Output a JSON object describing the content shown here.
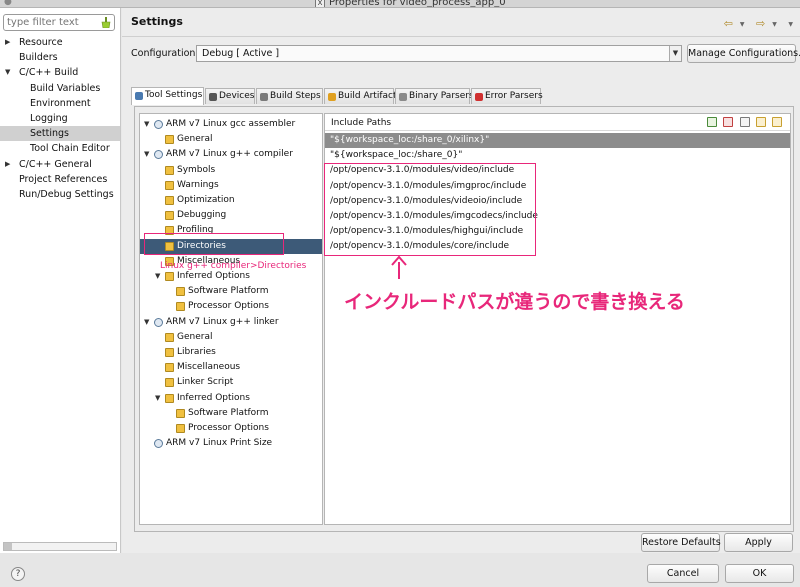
{
  "window": {
    "title": "Properties for video_process_app_0"
  },
  "sidebar": {
    "filter_placeholder": "type filter text",
    "items": [
      {
        "label": "Resource",
        "level": 0,
        "expandable": true,
        "expanded": false
      },
      {
        "label": "Builders",
        "level": 0,
        "expandable": false
      },
      {
        "label": "C/C++ Build",
        "level": 0,
        "expandable": true,
        "expanded": true
      },
      {
        "label": "Build Variables",
        "level": 1
      },
      {
        "label": "Environment",
        "level": 1
      },
      {
        "label": "Logging",
        "level": 1
      },
      {
        "label": "Settings",
        "level": 1,
        "selected": true
      },
      {
        "label": "Tool Chain Editor",
        "level": 1
      },
      {
        "label": "C/C++ General",
        "level": 0,
        "expandable": true,
        "expanded": false
      },
      {
        "label": "Project References",
        "level": 0
      },
      {
        "label": "Run/Debug Settings",
        "level": 0
      }
    ]
  },
  "page": {
    "title": "Settings",
    "configuration_label": "Configuration:",
    "configuration_value": "Debug  [ Active ]",
    "manage_button": "Manage Configurations..."
  },
  "tabs": [
    {
      "label": "Tool Settings",
      "active": true,
      "icon_color": "#4a7ab0"
    },
    {
      "label": "Devices",
      "icon_color": "#555555"
    },
    {
      "label": "Build Steps",
      "icon_color": "#7a7a7a"
    },
    {
      "label": "Build Artifact",
      "icon_color": "#e0a020"
    },
    {
      "label": "Binary Parsers",
      "icon_color": "#8a8a8a"
    },
    {
      "label": "Error Parsers",
      "icon_color": "#d03030"
    }
  ],
  "tree": [
    {
      "label": "ARM v7 Linux gcc assembler",
      "level": 0,
      "type": "tool"
    },
    {
      "label": "General",
      "level": 1,
      "type": "option"
    },
    {
      "label": "ARM v7 Linux g++ compiler",
      "level": 0,
      "type": "tool"
    },
    {
      "label": "Symbols",
      "level": 1,
      "type": "option"
    },
    {
      "label": "Warnings",
      "level": 1,
      "type": "option"
    },
    {
      "label": "Optimization",
      "level": 1,
      "type": "option"
    },
    {
      "label": "Debugging",
      "level": 1,
      "type": "option"
    },
    {
      "label": "Profiling",
      "level": 1,
      "type": "option"
    },
    {
      "label": "Directories",
      "level": 1,
      "type": "option",
      "selected": true
    },
    {
      "label": "Miscellaneous",
      "level": 1,
      "type": "option"
    },
    {
      "label": "Inferred Options",
      "level": 1,
      "type": "group"
    },
    {
      "label": "Software Platform",
      "level": 2,
      "type": "option"
    },
    {
      "label": "Processor Options",
      "level": 2,
      "type": "option"
    },
    {
      "label": "ARM v7 Linux g++ linker",
      "level": 0,
      "type": "tool"
    },
    {
      "label": "General",
      "level": 1,
      "type": "option"
    },
    {
      "label": "Libraries",
      "level": 1,
      "type": "option"
    },
    {
      "label": "Miscellaneous",
      "level": 1,
      "type": "option"
    },
    {
      "label": "Linker Script",
      "level": 1,
      "type": "option"
    },
    {
      "label": "Inferred Options",
      "level": 1,
      "type": "group"
    },
    {
      "label": "Software Platform",
      "level": 2,
      "type": "option"
    },
    {
      "label": "Processor Options",
      "level": 2,
      "type": "option"
    },
    {
      "label": "ARM v7 Linux Print Size",
      "level": 0,
      "type": "tool-leaf"
    }
  ],
  "include_paths": {
    "title": "Include Paths",
    "items": [
      {
        "value": "\"${workspace_loc:/share_0/xilinx}\"",
        "selected": true
      },
      {
        "value": "\"${workspace_loc:/share_0}\""
      },
      {
        "value": "/opt/opencv-3.1.0/modules/video/include"
      },
      {
        "value": "/opt/opencv-3.1.0/modules/imgproc/include"
      },
      {
        "value": "/opt/opencv-3.1.0/modules/videoio/include"
      },
      {
        "value": "/opt/opencv-3.1.0/modules/imgcodecs/include"
      },
      {
        "value": "/opt/opencv-3.1.0/modules/highgui/include"
      },
      {
        "value": "/opt/opencv-3.1.0/modules/core/include"
      }
    ]
  },
  "annotations": {
    "directories_label": "Linux g++ compiler>Directories",
    "callout_text": "インクルードパスが違うので書き換える",
    "color": "#e8277a"
  },
  "buttons": {
    "restore_defaults": "Restore Defaults",
    "apply": "Apply",
    "cancel": "Cancel",
    "ok": "OK"
  }
}
